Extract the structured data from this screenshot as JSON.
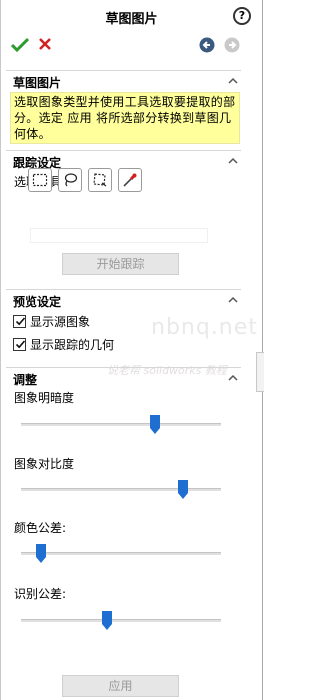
{
  "title": "草图图片",
  "help_glyph": "?",
  "sections": {
    "sketch_picture": {
      "title": "草图图片",
      "message": "选取图象类型并使用工具选取要提取的部分。选定 应用 将所选部分转换到草图几何体。"
    },
    "tracking": {
      "title": "跟踪设定",
      "select_tool_label": "选取工具:",
      "tools": [
        "selection-tool-icon",
        "lasso-tool-icon",
        "polygon-lasso-tool-icon",
        "color-picker-icon"
      ],
      "start_button": "开始跟踪"
    },
    "preview": {
      "title": "预览设定",
      "checkboxes": [
        {
          "label": "显示源图象",
          "checked": true
        },
        {
          "label": "显示跟踪的几何",
          "checked": true
        }
      ]
    },
    "adjust": {
      "title": "调整",
      "sliders": [
        {
          "label": "图象明暗度",
          "value": 0.67
        },
        {
          "label": "图象对比度",
          "value": 0.81
        },
        {
          "label": "颜色公差:",
          "value": 0.1
        },
        {
          "label": "识别公差:",
          "value": 0.43
        }
      ],
      "apply_button": "应用"
    }
  },
  "watermark": {
    "main": "nbnq.net",
    "sub": "说老帮 solidworks 教程"
  },
  "colors": {
    "message_bg": "#ffff9b",
    "ok_green": "#2e9b2e",
    "cancel_red": "#d22020",
    "slider_thumb": "#1e6fd0"
  }
}
